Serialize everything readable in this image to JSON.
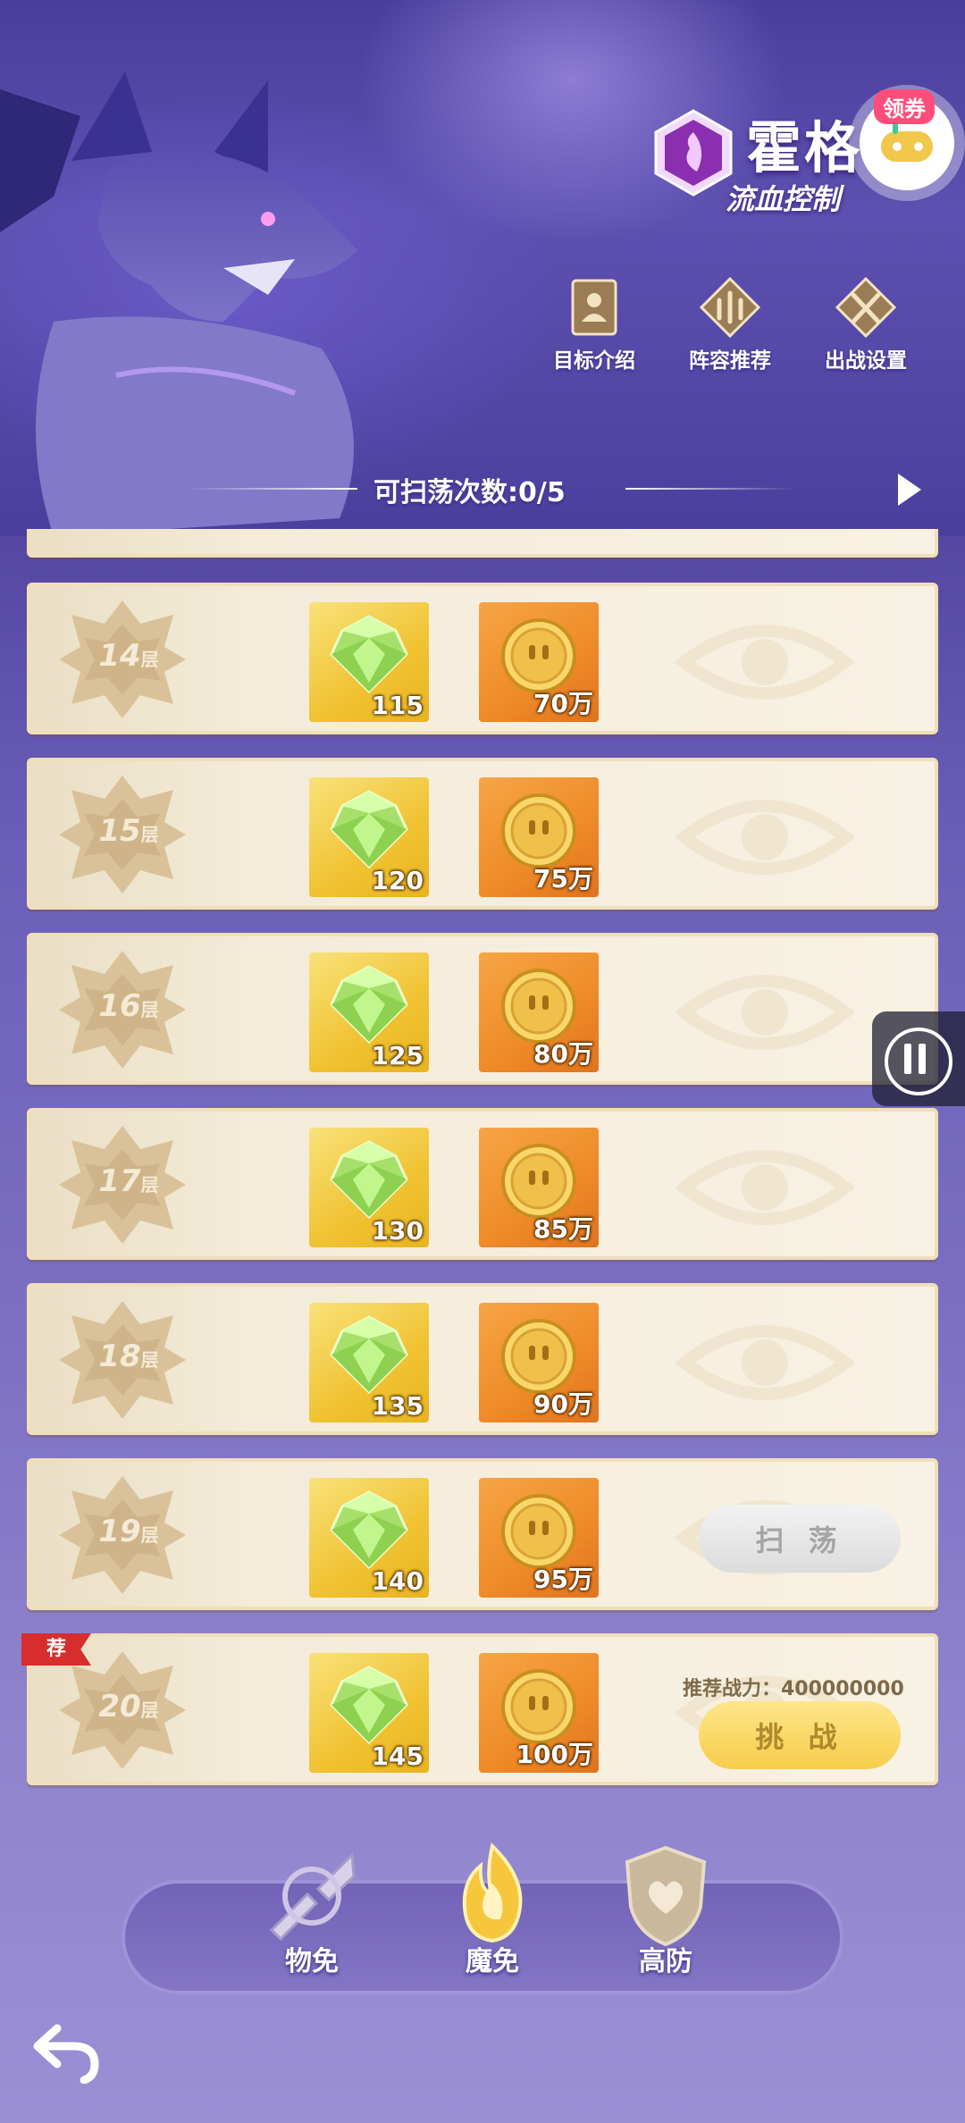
{
  "hero": {
    "boss_name": "霍格",
    "boss_subtitle": "流血控制",
    "coupon_label": "领券",
    "buttons": [
      {
        "label": "目标介绍"
      },
      {
        "label": "阵容推荐"
      },
      {
        "label": "出战设置"
      }
    ],
    "sweep_count": "可扫荡次数:0/5"
  },
  "floors": [
    {
      "floor": "14",
      "floor_suffix": "层",
      "gems": "115",
      "gold": "70万"
    },
    {
      "floor": "15",
      "floor_suffix": "层",
      "gems": "120",
      "gold": "75万"
    },
    {
      "floor": "16",
      "floor_suffix": "层",
      "gems": "125",
      "gold": "80万"
    },
    {
      "floor": "17",
      "floor_suffix": "层",
      "gems": "130",
      "gold": "85万"
    },
    {
      "floor": "18",
      "floor_suffix": "层",
      "gems": "135",
      "gold": "90万"
    },
    {
      "floor": "19",
      "floor_suffix": "层",
      "gems": "140",
      "gold": "95万",
      "action": "扫 荡"
    },
    {
      "floor": "20",
      "floor_suffix": "层",
      "gems": "145",
      "gold": "100万",
      "tag": "荐",
      "power_text": "推荐战力：400000000",
      "action": "挑 战"
    }
  ],
  "tabs": [
    {
      "label": "物免"
    },
    {
      "label": "魔免"
    },
    {
      "label": "高防"
    }
  ],
  "colors": {
    "row_bg": "#f4ecd9",
    "gem_tile": "#f0c232",
    "gold_tile": "#ef8a28",
    "challenge_button": "#f7cd4a",
    "recommend_tag": "#d62d2d"
  }
}
